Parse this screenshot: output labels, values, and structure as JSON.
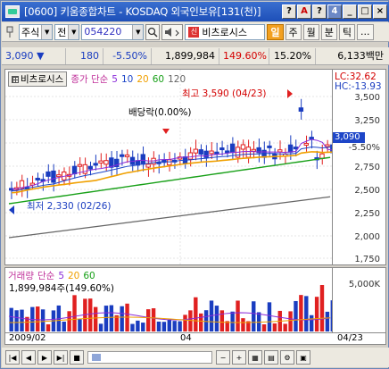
{
  "window": {
    "title": "[0600] 키움종합차트 - KOSDAQ 외국인보유[131(천)]",
    "buttons": [
      "?",
      "A",
      "?",
      "4",
      "_",
      "□",
      "×"
    ]
  },
  "toolbar": {
    "market": "주식",
    "prev_label": "전",
    "code": "054220",
    "stock_name": "비츠로시스",
    "btn_day": "일",
    "btn_week": "주",
    "btn_month": "월",
    "btn_minute": "분",
    "btn_tick": "틱",
    "btn_more": "..."
  },
  "quote": {
    "price": "3,090",
    "change_arrow": "▼",
    "change": "180",
    "change_pct": "-5.50%",
    "volume": "1,899,984",
    "volume_ratio": "149.60%",
    "turnover": "15.20%",
    "amount": "6,133백만"
  },
  "price_panel": {
    "name_chip": "비츠로시스",
    "legend_label": "종가 단순",
    "ma": [
      "5",
      "10",
      "20",
      "60",
      "120"
    ],
    "lc": "LC:32.62",
    "hc": "HC:-13.93",
    "high_annotation": "최고 3,590 (04/23)",
    "low_annotation": "최저 2,330 (02/26)",
    "dividend_annotation": "배당락(0.00%)",
    "current_price_box": "3,090",
    "current_pct": "-5.50%",
    "y_ticks": [
      "3,500",
      "3,250",
      "3,000",
      "2,750",
      "2,500",
      "2,250",
      "2,000",
      "1,750"
    ]
  },
  "volume_panel": {
    "legend_label": "거래량",
    "legend_ma_label": "단순",
    "ma": [
      "5",
      "20",
      "60"
    ],
    "value_annotation": "1,899,984주(149.60%)",
    "y_tick": "5,000K"
  },
  "x_axis": {
    "labels": [
      "2009/02",
      "04",
      "04/23"
    ]
  },
  "colors": {
    "up": "#e02020",
    "down": "#1a3dc0",
    "ma5": "#8b2bd9",
    "ma10": "#1e46c8",
    "ma20": "#f0a000",
    "ma60": "#18a018",
    "ma120": "#666666"
  }
}
